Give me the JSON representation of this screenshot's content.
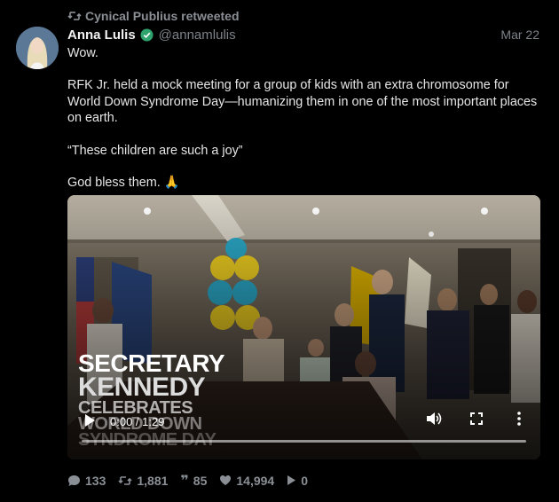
{
  "retweet": {
    "text": "Cynical Publius retweeted"
  },
  "author": {
    "name": "Anna Lulis",
    "handle": "@annamlulis",
    "date": "Mar 22"
  },
  "tweet": {
    "lines": [
      "Wow.",
      "RFK Jr. held a mock meeting for a group of kids with an extra chromosome for World Down Syndrome Day—humanizing them in one of the most important places on earth.",
      "“These children are such a joy”",
      "God bless them. 🙏"
    ]
  },
  "video": {
    "overlay_line1": "SECRETARY",
    "overlay_line2": "KENNEDY",
    "overlay_line3": "CELEBRATES",
    "overlay_line4": "WORLD DOWN",
    "overlay_line5": "SYNDROME DAY",
    "time": "0:00 / 1:29",
    "progress": 0.0
  },
  "stats": {
    "replies": "133",
    "retweets": "1,881",
    "quotes": "85",
    "likes": "14,994",
    "views": "0"
  },
  "colors": {
    "background": "#000000",
    "muted": "#8a8f95",
    "verified": "#2ea36e"
  }
}
